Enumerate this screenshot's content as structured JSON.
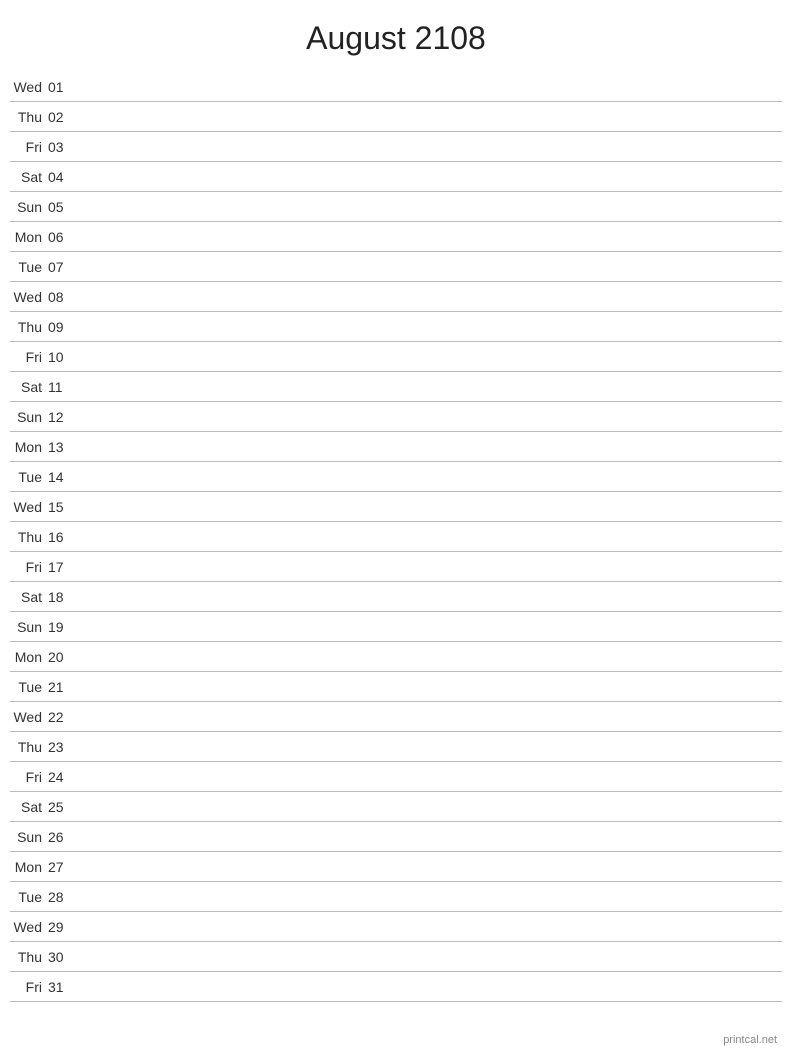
{
  "title": "August 2108",
  "footer": "printcal.net",
  "days": [
    {
      "name": "Wed",
      "number": "01"
    },
    {
      "name": "Thu",
      "number": "02"
    },
    {
      "name": "Fri",
      "number": "03"
    },
    {
      "name": "Sat",
      "number": "04"
    },
    {
      "name": "Sun",
      "number": "05"
    },
    {
      "name": "Mon",
      "number": "06"
    },
    {
      "name": "Tue",
      "number": "07"
    },
    {
      "name": "Wed",
      "number": "08"
    },
    {
      "name": "Thu",
      "number": "09"
    },
    {
      "name": "Fri",
      "number": "10"
    },
    {
      "name": "Sat",
      "number": "11"
    },
    {
      "name": "Sun",
      "number": "12"
    },
    {
      "name": "Mon",
      "number": "13"
    },
    {
      "name": "Tue",
      "number": "14"
    },
    {
      "name": "Wed",
      "number": "15"
    },
    {
      "name": "Thu",
      "number": "16"
    },
    {
      "name": "Fri",
      "number": "17"
    },
    {
      "name": "Sat",
      "number": "18"
    },
    {
      "name": "Sun",
      "number": "19"
    },
    {
      "name": "Mon",
      "number": "20"
    },
    {
      "name": "Tue",
      "number": "21"
    },
    {
      "name": "Wed",
      "number": "22"
    },
    {
      "name": "Thu",
      "number": "23"
    },
    {
      "name": "Fri",
      "number": "24"
    },
    {
      "name": "Sat",
      "number": "25"
    },
    {
      "name": "Sun",
      "number": "26"
    },
    {
      "name": "Mon",
      "number": "27"
    },
    {
      "name": "Tue",
      "number": "28"
    },
    {
      "name": "Wed",
      "number": "29"
    },
    {
      "name": "Thu",
      "number": "30"
    },
    {
      "name": "Fri",
      "number": "31"
    }
  ]
}
